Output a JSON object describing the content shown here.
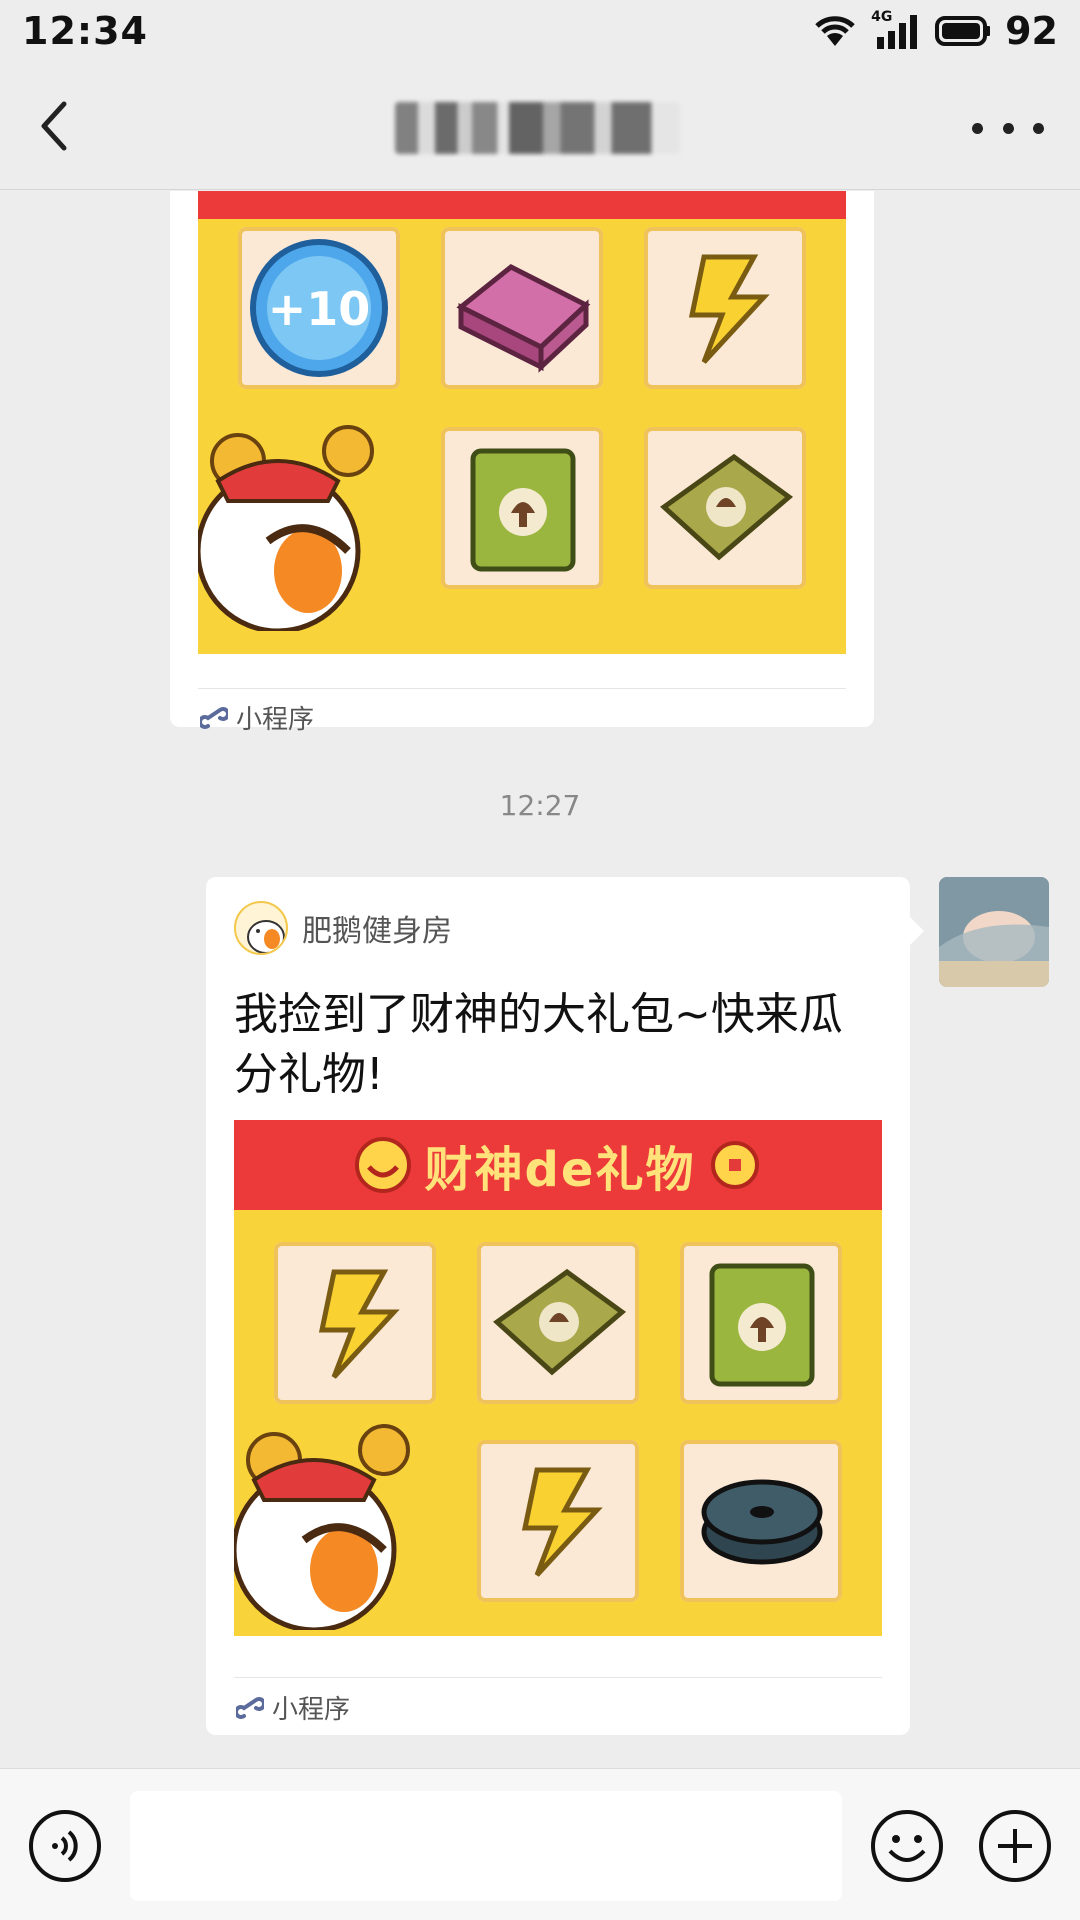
{
  "status": {
    "time": "12:34",
    "network": "4G",
    "battery": "92"
  },
  "header": {
    "title": "▮▮▮▮▮▮▮▮"
  },
  "messages": [
    {
      "type": "mini_program_card",
      "image": "caishen-gift-grid",
      "footer_label": "小程序"
    },
    {
      "type": "timestamp",
      "text": "12:27"
    },
    {
      "type": "mini_program_card",
      "app_name": "肥鹅健身房",
      "text": "我捡到了财神的大礼包~快来瓜分礼物!",
      "image_title": "财神de礼物",
      "footer_label": "小程序"
    }
  ],
  "input": {
    "placeholder": "",
    "value": ""
  },
  "colors": {
    "background": "#ededed",
    "card": "#ffffff",
    "banner_red": "#ec3a3a",
    "gift_yellow": "#f8d43a"
  }
}
